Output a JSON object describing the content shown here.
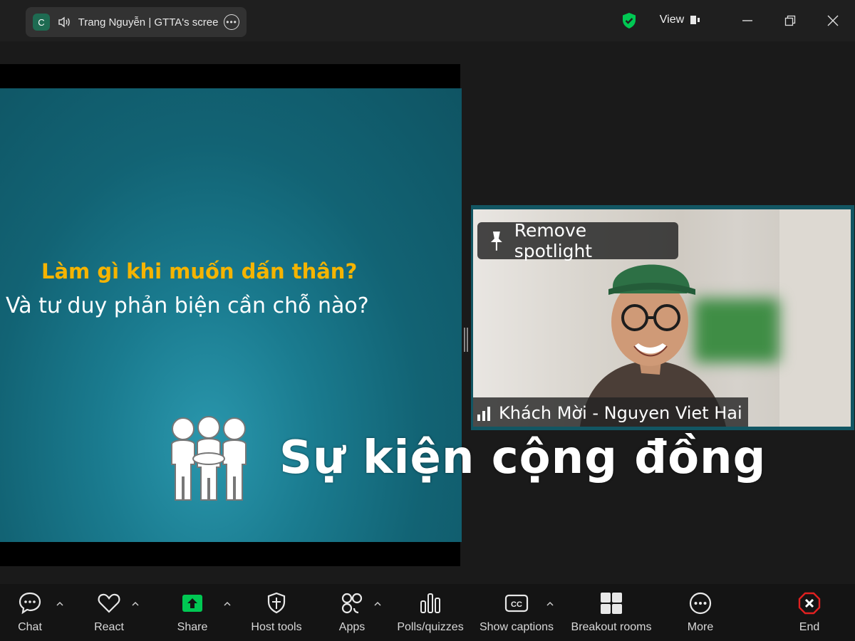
{
  "titlebar": {
    "share_avatar_letter": "C",
    "share_title": "Trang Nguyễn | GTTA's scree",
    "view_label": "View"
  },
  "slide": {
    "question_1": "Làm gì khi muốn dấn thân?",
    "question_2": "Và tư duy phản biện cần chỗ nào?"
  },
  "overlay": {
    "event_text": "Sự kiện cộng đồng"
  },
  "video": {
    "remove_spotlight_label": "Remove spotlight",
    "participant_name": "Khách Mời - Nguyen Viet Hai"
  },
  "toolbar": {
    "chat": "Chat",
    "react": "React",
    "share": "Share",
    "host_tools": "Host tools",
    "apps": "Apps",
    "polls": "Polls/quizzes",
    "captions": "Show captions",
    "breakout": "Breakout rooms",
    "more": "More",
    "end": "End"
  },
  "colors": {
    "accent_green": "#00c853",
    "end_red": "#e02020",
    "slide_yellow": "#f5b400",
    "slide_teal": "#126374"
  }
}
